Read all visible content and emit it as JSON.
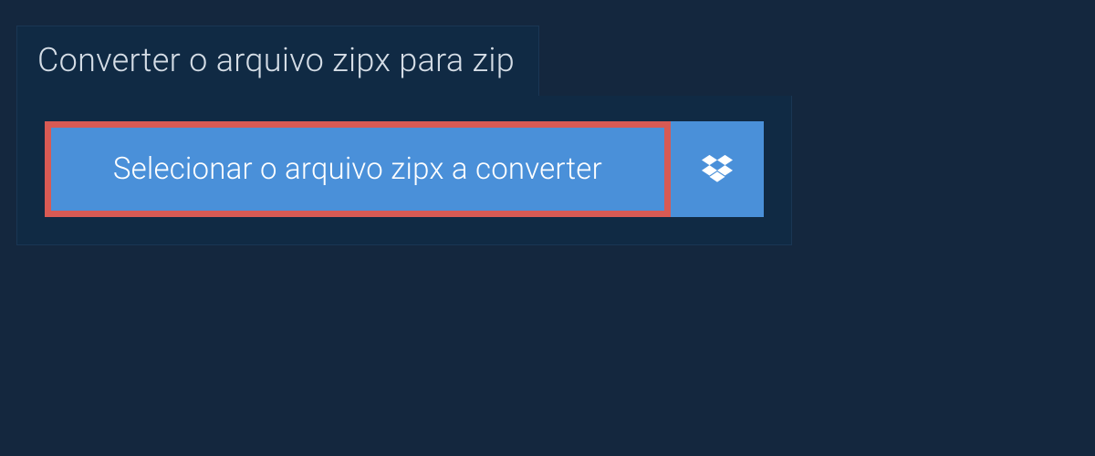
{
  "tab": {
    "title": "Converter o arquivo zipx para zip"
  },
  "buttons": {
    "select_file": "Selecionar o arquivo zipx a converter"
  },
  "colors": {
    "background": "#14273e",
    "panel": "#102a44",
    "button_primary": "#4a90d9",
    "highlight_border": "#d85a54",
    "text_light": "#d5dde6"
  }
}
